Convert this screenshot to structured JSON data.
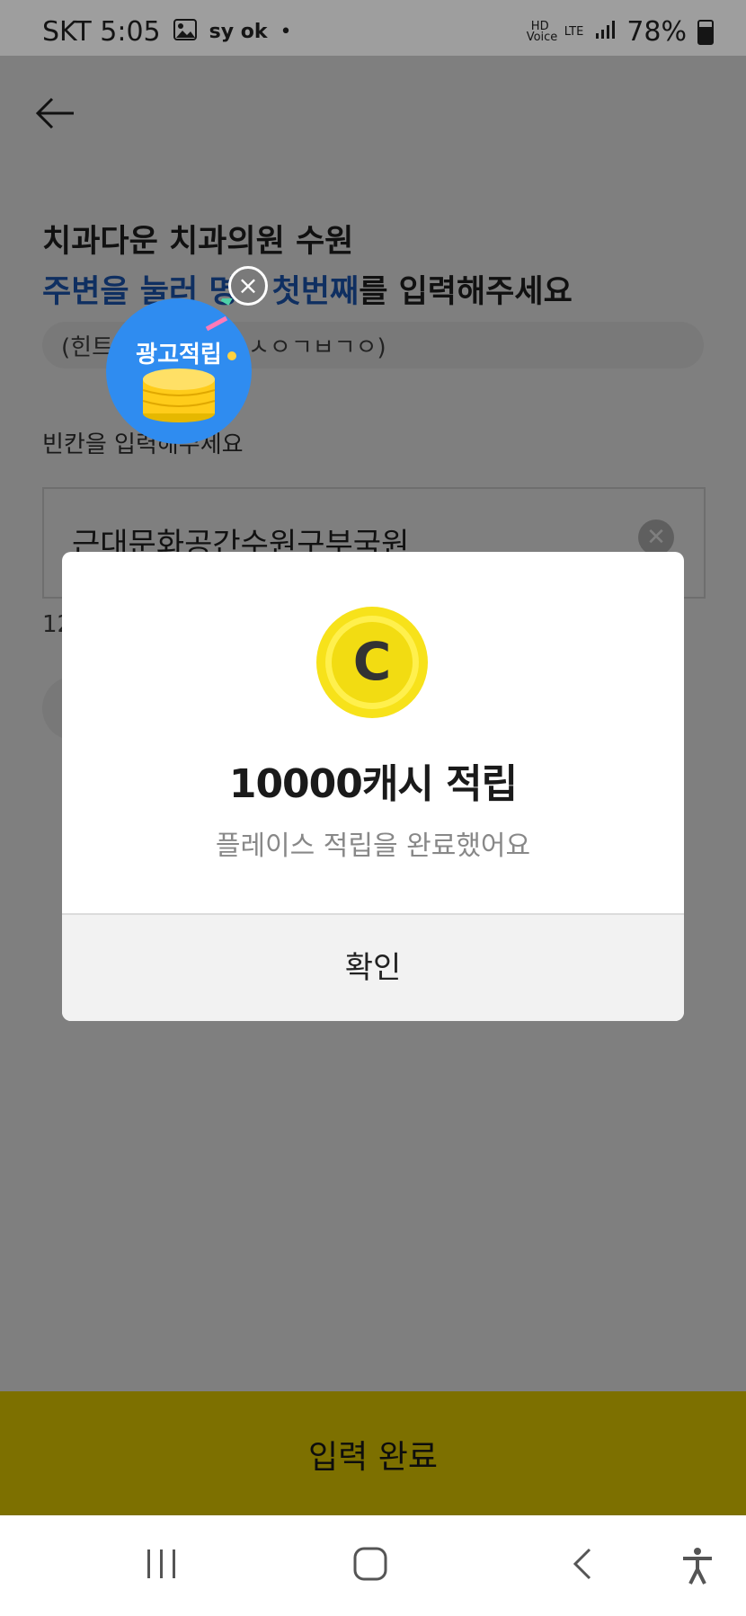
{
  "status_bar": {
    "carrier_time": "SKT 5:05",
    "app_glyphs": "sy ok",
    "dot": "•",
    "hd_voice": "HD Voice",
    "lte": "LTE",
    "battery": "78%",
    "icons": [
      "gallery-icon",
      "signal-icon",
      "battery-icon"
    ]
  },
  "page": {
    "title_line1": "치과다운 치과의원 수원",
    "title_line2_blue_a": "주변을 눌러 명",
    "title_line2_blue_b": "첫번째",
    "title_line2_rest": "를 입력해주세요",
    "hint_prefix": "(힌트",
    "hint_suffix": "ㅅㅇㄱㅂㄱㅇ)",
    "blank_label": "빈칸을 입력해주세요",
    "input_value": "근대문화공간수원구부국원",
    "char_count": "12",
    "submit_label": "입력 완료"
  },
  "ad_bubble": {
    "label": "광고적립"
  },
  "modal": {
    "title": "10000캐시 적립",
    "subtitle": "플레이스 적립을 완료했어요",
    "confirm_label": "확인",
    "coin_letter": "C"
  },
  "colors": {
    "accent_yellow": "#fae100",
    "title_blue": "#1f5fc2",
    "ad_blue": "#2f8cf0"
  }
}
